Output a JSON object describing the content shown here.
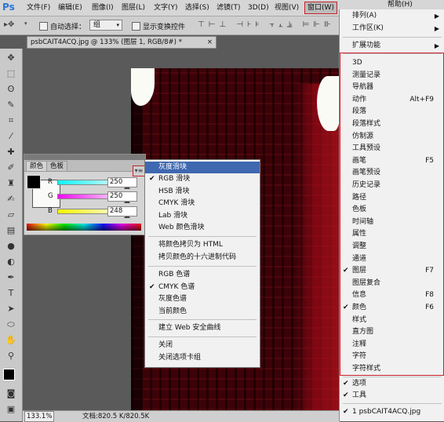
{
  "app": {
    "logo": "Ps"
  },
  "menubar": {
    "items": [
      "文件(F)",
      "编辑(E)",
      "图像(I)",
      "图层(L)",
      "文字(Y)",
      "选择(S)",
      "滤镜(T)",
      "3D(D)",
      "视图(V)"
    ],
    "window": "窗口(W)",
    "help": "帮助(H)"
  },
  "options_bar": {
    "auto_select_label": "自动选择：",
    "auto_select_value": "组",
    "show_transform_label": "显示变换控件"
  },
  "document_tab": {
    "title": "psbCAIT4ACQ.jpg @ 133% (图层 1, RGB/8#) *",
    "close": "×"
  },
  "status_bar": {
    "zoom": "133.1%",
    "doc_info": "文档:820.5 K/820.5K"
  },
  "color_panel": {
    "tabs": [
      "颜色",
      "色板"
    ],
    "menu_icon": "▾≡",
    "sliders": [
      {
        "label": "R",
        "value": "250"
      },
      {
        "label": "G",
        "value": "250"
      },
      {
        "label": "B",
        "value": "248"
      }
    ],
    "foreground": "#000000",
    "background": "#fafaf8"
  },
  "panel_menu": {
    "items": [
      {
        "label": "灰度滑块",
        "checked": false,
        "highlighted": true
      },
      {
        "label": "RGB 滑块",
        "checked": true
      },
      {
        "label": "HSB 滑块",
        "checked": false
      },
      {
        "label": "CMYK 滑块",
        "checked": false
      },
      {
        "label": "Lab 滑块",
        "checked": false
      },
      {
        "label": "Web 颜色滑块",
        "checked": false
      },
      {
        "label": "将颜色拷贝为 HTML",
        "checked": false
      },
      {
        "label": "拷贝颜色的十六进制代码",
        "checked": false
      },
      {
        "label": "RGB 色谱",
        "checked": false
      },
      {
        "label": "CMYK 色谱",
        "checked": true
      },
      {
        "label": "灰度色谱",
        "checked": false
      },
      {
        "label": "当前颜色",
        "checked": false
      },
      {
        "label": "建立 Web 安全曲线",
        "checked": false
      },
      {
        "label": "关闭",
        "checked": false
      },
      {
        "label": "关闭选项卡组",
        "checked": false
      }
    ]
  },
  "window_menu": {
    "top_items": [
      {
        "label": "排列(A)",
        "submenu": true
      },
      {
        "label": "工作区(K)",
        "submenu": true
      },
      {
        "label": "扩展功能",
        "submenu": true
      }
    ],
    "panel_items": [
      {
        "label": "3D",
        "shortcut": "",
        "checked": false
      },
      {
        "label": "测量记录",
        "shortcut": "",
        "checked": false
      },
      {
        "label": "导航器",
        "shortcut": "",
        "checked": false
      },
      {
        "label": "动作",
        "shortcut": "Alt+F9",
        "checked": false
      },
      {
        "label": "段落",
        "shortcut": "",
        "checked": false
      },
      {
        "label": "段落样式",
        "shortcut": "",
        "checked": false
      },
      {
        "label": "仿制源",
        "shortcut": "",
        "checked": false
      },
      {
        "label": "工具预设",
        "shortcut": "",
        "checked": false
      },
      {
        "label": "画笔",
        "shortcut": "F5",
        "checked": false
      },
      {
        "label": "画笔预设",
        "shortcut": "",
        "checked": false
      },
      {
        "label": "历史记录",
        "shortcut": "",
        "checked": false
      },
      {
        "label": "路径",
        "shortcut": "",
        "checked": false
      },
      {
        "label": "色板",
        "shortcut": "",
        "checked": false
      },
      {
        "label": "时间轴",
        "shortcut": "",
        "checked": false
      },
      {
        "label": "属性",
        "shortcut": "",
        "checked": false
      },
      {
        "label": "调整",
        "shortcut": "",
        "checked": false
      },
      {
        "label": "通道",
        "shortcut": "",
        "checked": false
      },
      {
        "label": "图层",
        "shortcut": "F7",
        "checked": true
      },
      {
        "label": "图层复合",
        "shortcut": "",
        "checked": false
      },
      {
        "label": "信息",
        "shortcut": "F8",
        "checked": false
      },
      {
        "label": "颜色",
        "shortcut": "F6",
        "checked": true
      },
      {
        "label": "样式",
        "shortcut": "",
        "checked": false
      },
      {
        "label": "直方图",
        "shortcut": "",
        "checked": false
      },
      {
        "label": "注释",
        "shortcut": "",
        "checked": false
      },
      {
        "label": "字符",
        "shortcut": "",
        "checked": false
      },
      {
        "label": "字符样式",
        "shortcut": "",
        "checked": false
      }
    ],
    "bottom_items": [
      {
        "label": "选项",
        "checked": true
      },
      {
        "label": "工具",
        "checked": true
      }
    ],
    "documents": [
      {
        "label": "1 psbCAIT4ACQ.jpg",
        "checked": true
      }
    ]
  },
  "colors": {
    "highlight": "#3f68b0",
    "annotation_red": "#c8202c"
  }
}
